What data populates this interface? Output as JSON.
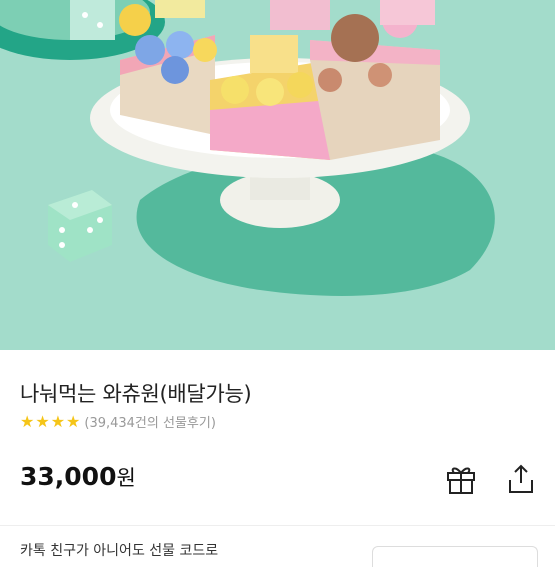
{
  "product": {
    "title": "나눠먹는 와츄원(배달가능)",
    "rating_stars": 4,
    "review_count": "(39,434건의 선물후기)",
    "price_value": "33,000",
    "price_unit": "원",
    "partial_text": "카톡 친구가 아니어도 선물 코드로"
  },
  "icons": {
    "gift": "gift-icon",
    "share": "share-icon",
    "star": "star-icon"
  },
  "colors": {
    "star": "#f5c518",
    "hero_bg": "#a3dccb"
  }
}
